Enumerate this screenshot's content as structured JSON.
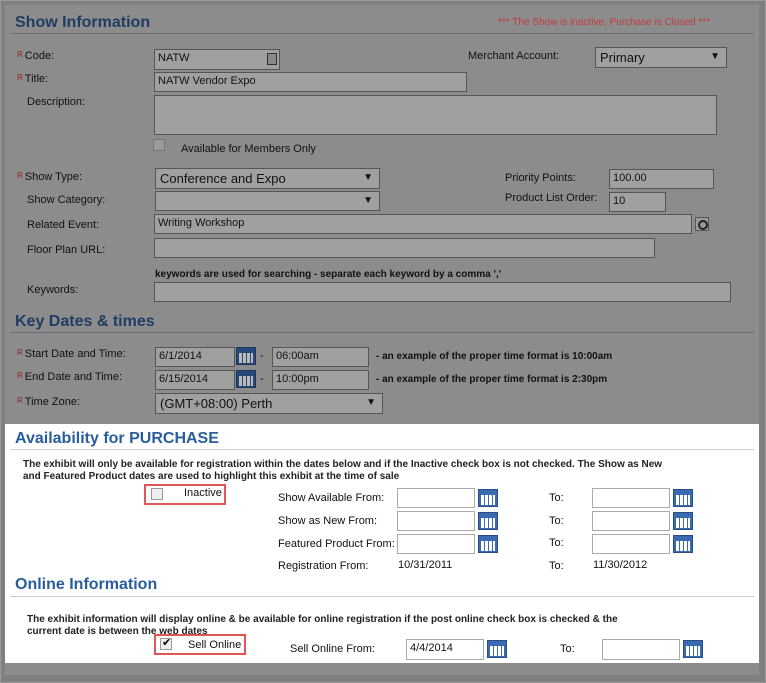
{
  "show_info": {
    "heading": "Show Information",
    "status_msg": "*** The Show is inactive, Purchase is Closed ***",
    "code_label": "Code:",
    "code_value": "NATW",
    "merchant_label": "Merchant Account:",
    "merchant_value": "Primary",
    "title_label": "Title:",
    "title_value": "NATW Vendor Expo",
    "description_label": "Description:",
    "members_only_label": "Available for Members Only",
    "show_type_label": "Show Type:",
    "show_type_value": "Conference and Expo",
    "priority_label": "Priority Points:",
    "priority_value": "100.00",
    "category_label": "Show Category:",
    "category_value": "",
    "product_order_label": "Product List Order:",
    "product_order_value": "10",
    "related_label": "Related Event:",
    "related_value": "Writing Workshop",
    "floor_label": "Floor Plan URL:",
    "floor_value": "",
    "keywords_hint": "keywords are used for searching - separate each keyword by a comma ','",
    "keywords_label": "Keywords:",
    "keywords_value": "",
    "required_mark": "R"
  },
  "key_dates": {
    "heading": "Key Dates & times",
    "start_label": "Start Date and Time:",
    "start_date": "6/1/2014",
    "start_time": "06:00am",
    "start_hint": "- an example of the proper time format is 10:00am",
    "end_label": "End Date and Time:",
    "end_date": "6/15/2014",
    "end_time": "10:00pm",
    "end_hint": "- an example of the proper time format is 2:30pm",
    "tz_label": "Time Zone:",
    "tz_value": "(GMT+08:00) Perth",
    "dash": "-"
  },
  "availability": {
    "heading": "Availability for PURCHASE",
    "desc1": "The exhibit will only be available for registration within the dates below and if the Inactive check box is not checked. The Show as New",
    "desc2": "and Featured Product dates are used to highlight this exhibit at the time of sale",
    "inactive_label": "Inactive",
    "show_from_label": "Show Available From:",
    "new_from_label": "Show as New From:",
    "featured_label": "Featured Product From:",
    "reg_from_label": "Registration From:",
    "to_label": "To:",
    "reg_from_value": "10/31/2011",
    "reg_to_value": "11/30/2012"
  },
  "online": {
    "heading": "Online Information",
    "desc1": "The exhibit information will display online & be available for online registration if the post online check box is checked & the",
    "desc2": "current date is between the web dates",
    "sell_label": "Sell Online",
    "sell_from_label": "Sell Online From:",
    "sell_from_value": "4/4/2014",
    "to_label": "To:",
    "to_value": ""
  },
  "icons": {
    "calendar": "calendar-icon",
    "dropdown": "chevron-down-icon",
    "search": "search-icon",
    "lock": "lock-icon",
    "check": "checkmark-icon"
  },
  "colors": {
    "heading": "#2a5d9c",
    "highlight": "#e05555",
    "overlay": "#8c8c8c",
    "status": "#c43b3b"
  }
}
